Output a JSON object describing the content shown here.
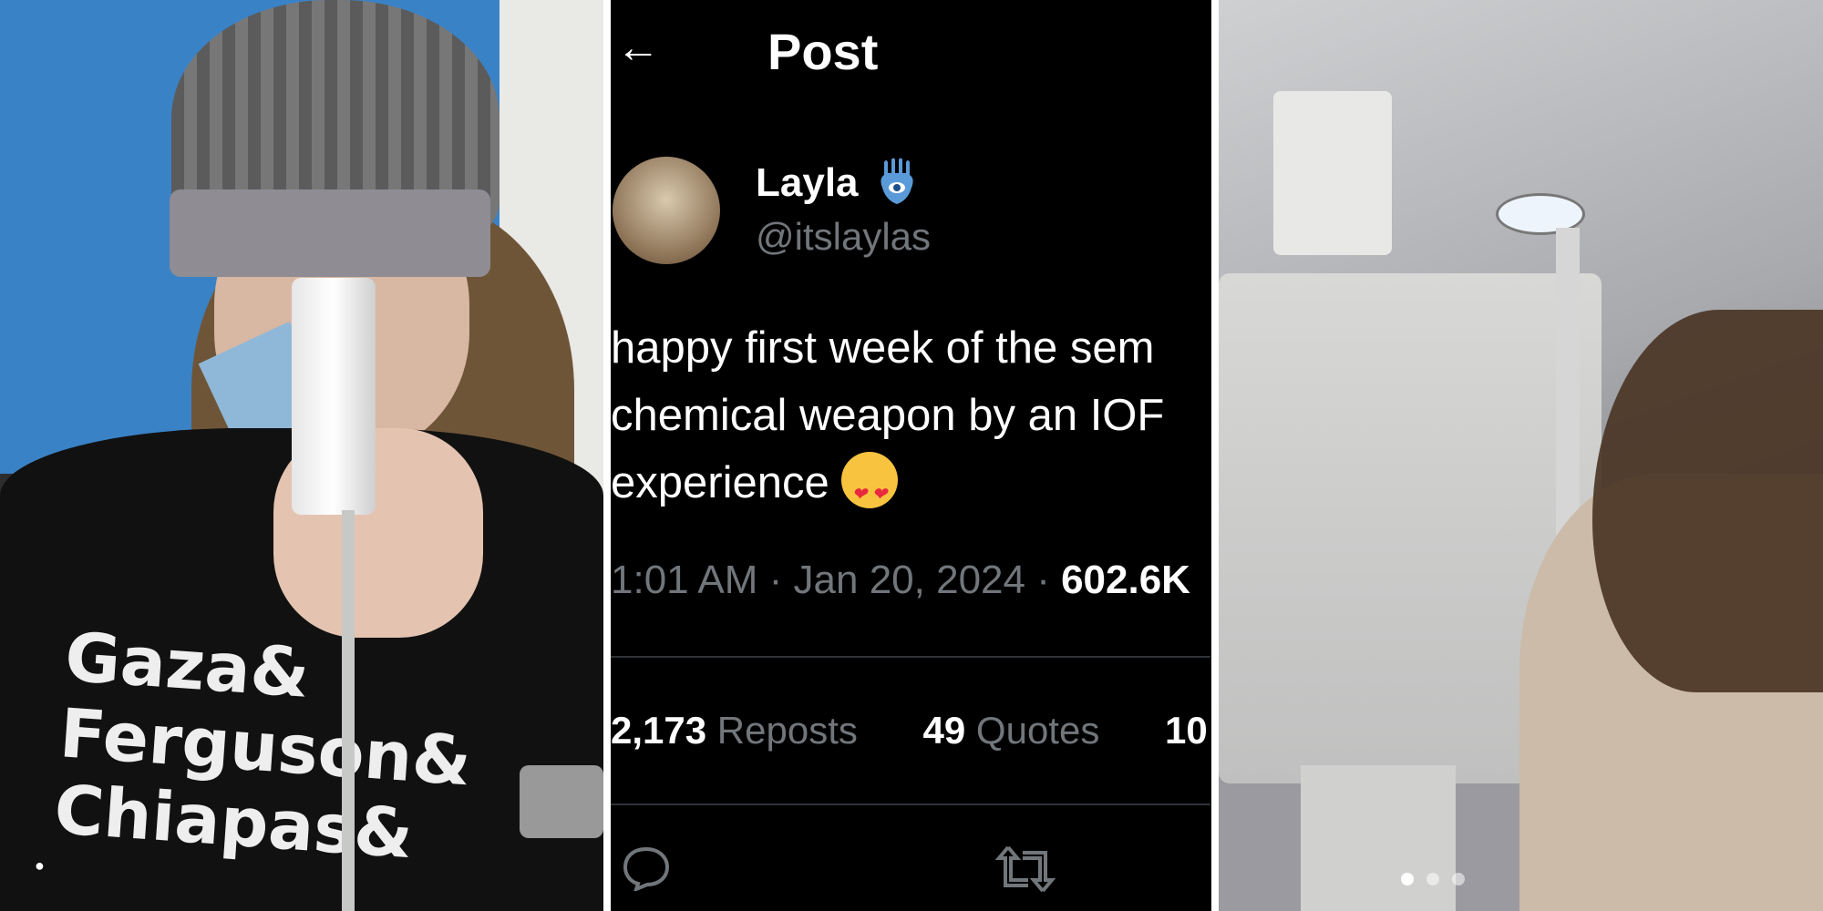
{
  "post": {
    "header_title": "Post",
    "author_name": "Layla",
    "author_handle": "@itslaylas",
    "text_lines": [
      "happy first week of the sem",
      "chemical weapon by an IOF",
      "experience"
    ],
    "time_date": "1:01 AM · Jan 20, 2024 · ",
    "views": "602.6K",
    "reposts_count": "2,173",
    "reposts_label": "Reposts",
    "quotes_count": "49",
    "quotes_label": "Quotes",
    "third_count": "10"
  },
  "left_photo": {
    "shirt_lines": [
      "Gaza&",
      "Ferguson&",
      "Chiapas&"
    ]
  },
  "right_photo": {
    "carousel_dots": 3,
    "active_dot": 0
  },
  "colors": {
    "background": "#000000",
    "text_primary": "#e7e9ea",
    "text_secondary": "#71767b",
    "divider": "#2f3336"
  }
}
